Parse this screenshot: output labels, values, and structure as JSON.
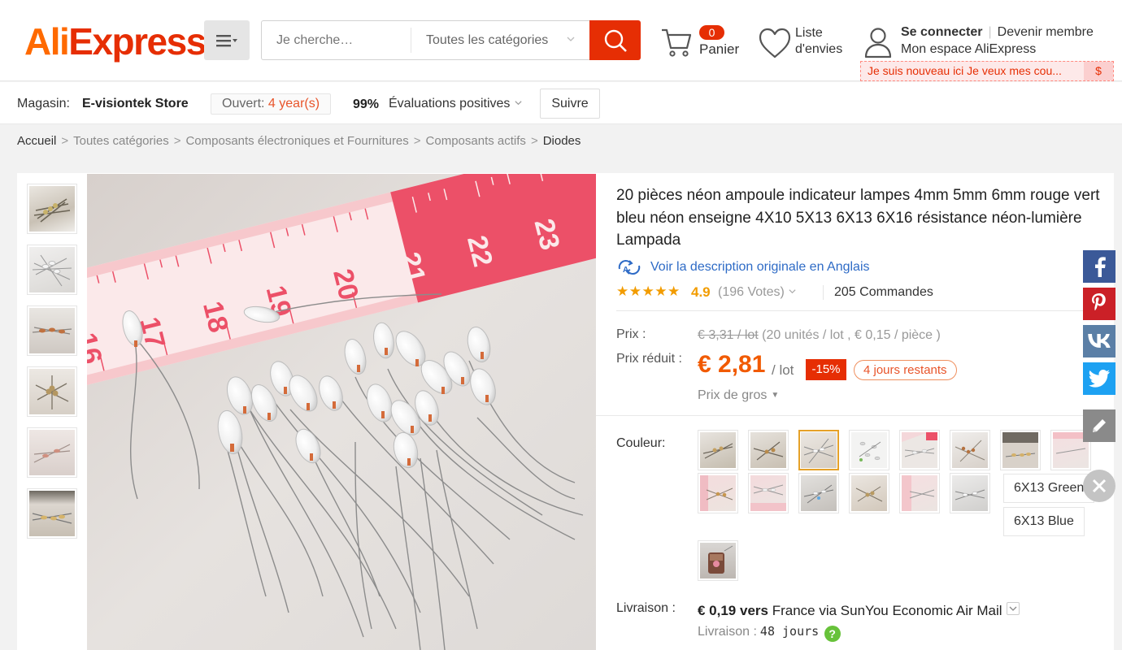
{
  "header": {
    "logo_text_1": "Ali",
    "logo_text_2": "Express",
    "logo_tm": "™",
    "search_placeholder": "Je cherche…",
    "search_category": "Toutes les catégories",
    "cart_count": "0",
    "cart_label": "Panier",
    "wishlist_label": "Liste d'envies",
    "signin": "Se connecter",
    "join": "Devenir membre",
    "my_account": "Mon espace AliExpress",
    "promo_text": "Je suis nouveau ici Je veux mes cou...",
    "promo_symbol": "$"
  },
  "store": {
    "label": "Magasin:",
    "name": "E-visiontek Store",
    "open_label": "Ouvert:",
    "open_value": "4 year(s)",
    "positive_pct": "99%",
    "positive_label": "Évaluations positives",
    "follow_label": "Suivre"
  },
  "breadcrumb": [
    "Accueil",
    "Toutes catégories",
    "Composants électroniques et Fournitures",
    "Composants actifs",
    "Diodes"
  ],
  "product": {
    "title": "20 pièces néon ampoule indicateur lampes 4mm 5mm 6mm rouge vert bleu néon enseigne 4X10 5X13 6X13 6X16 résistance néon-lumière Lampada",
    "translate_link": "Voir la description originale en Anglais",
    "stars": "★★★★★",
    "rating": "4.9",
    "votes": "(196 Votes)",
    "orders": "205 Commandes",
    "price_label": "Prix :",
    "old_price": "€ 3,31 / lot",
    "old_price_detail": "(20 unités / lot , € 0,15 / pièce )",
    "discount_label": "Prix réduit :",
    "new_price": "€ 2,81",
    "per_lot": "/ lot",
    "discount_badge": "-15%",
    "days_left": "4 jours restants",
    "wholesale": "Prix de gros",
    "color_label": "Couleur:",
    "text_options": [
      "6X13 Green",
      "6X13 Blue"
    ],
    "shipping_label": "Livraison :",
    "shipping_price": "€ 0,19 vers",
    "shipping_dest": "France via SunYou Economic Air Mail",
    "delivery_label": "Livraison :",
    "delivery_value": "48 jours",
    "help_symbol": "?"
  },
  "social": [
    "f",
    "P",
    "vk",
    "t"
  ],
  "colors": {
    "accent": "#e62e04",
    "orange": "#ff6a00",
    "price": "#f15a00",
    "link": "#2e6bc6",
    "facebook": "#3b5998",
    "pinterest": "#cb2027",
    "vk": "#5b7fa6",
    "twitter": "#1da1f2",
    "edit": "#888888"
  }
}
